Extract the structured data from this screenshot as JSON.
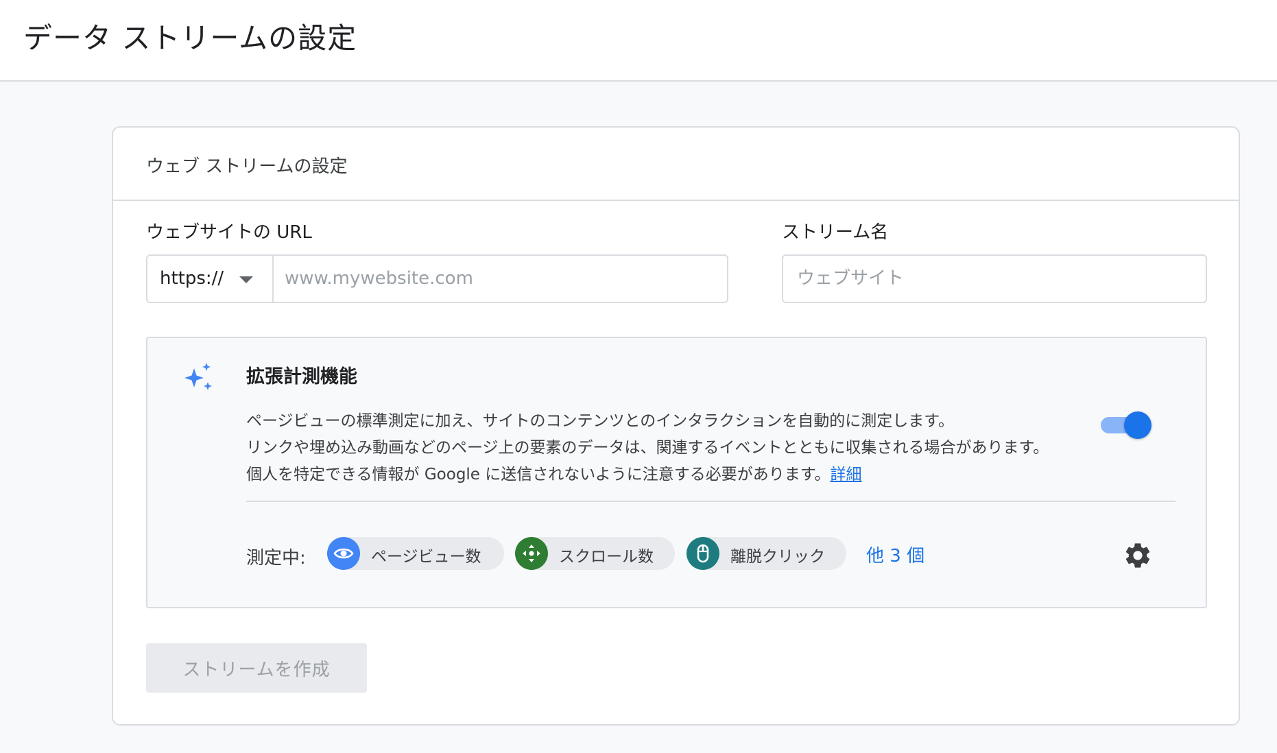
{
  "header": {
    "title": "データ ストリームの設定"
  },
  "card": {
    "title": "ウェブ ストリームの設定",
    "url_label": "ウェブサイトの URL",
    "protocol": "https://",
    "url_placeholder": "www.mywebsite.com",
    "name_label": "ストリーム名",
    "name_placeholder": "ウェブサイト"
  },
  "enhanced": {
    "title": "拡張計測機能",
    "desc_line1": "ページビューの標準測定に加え、サイトのコンテンツとのインタラクションを自動的に測定します。",
    "desc_line2": "リンクや埋め込み動画などのページ上の要素のデータは、関連するイベントとともに収集される場合があります。",
    "desc_line3": "個人を特定できる情報が Google に送信されないように注意する必要があります。",
    "learn_more": "詳細",
    "toggle_on": true,
    "measuring_label": "測定中:",
    "chips": [
      {
        "label": "ページビュー数",
        "icon": "eye-icon",
        "color": "#4285f4"
      },
      {
        "label": "スクロール数",
        "icon": "move-icon",
        "color": "#2e7d32"
      },
      {
        "label": "離脱クリック",
        "icon": "mouse-icon",
        "color": "#1e7c80"
      }
    ],
    "more": "他 3 個"
  },
  "actions": {
    "create_label": "ストリームを作成"
  },
  "colors": {
    "accent": "#1a73e8",
    "toggle_track": "#8ab4f8",
    "sparkle": "#4285f4"
  }
}
